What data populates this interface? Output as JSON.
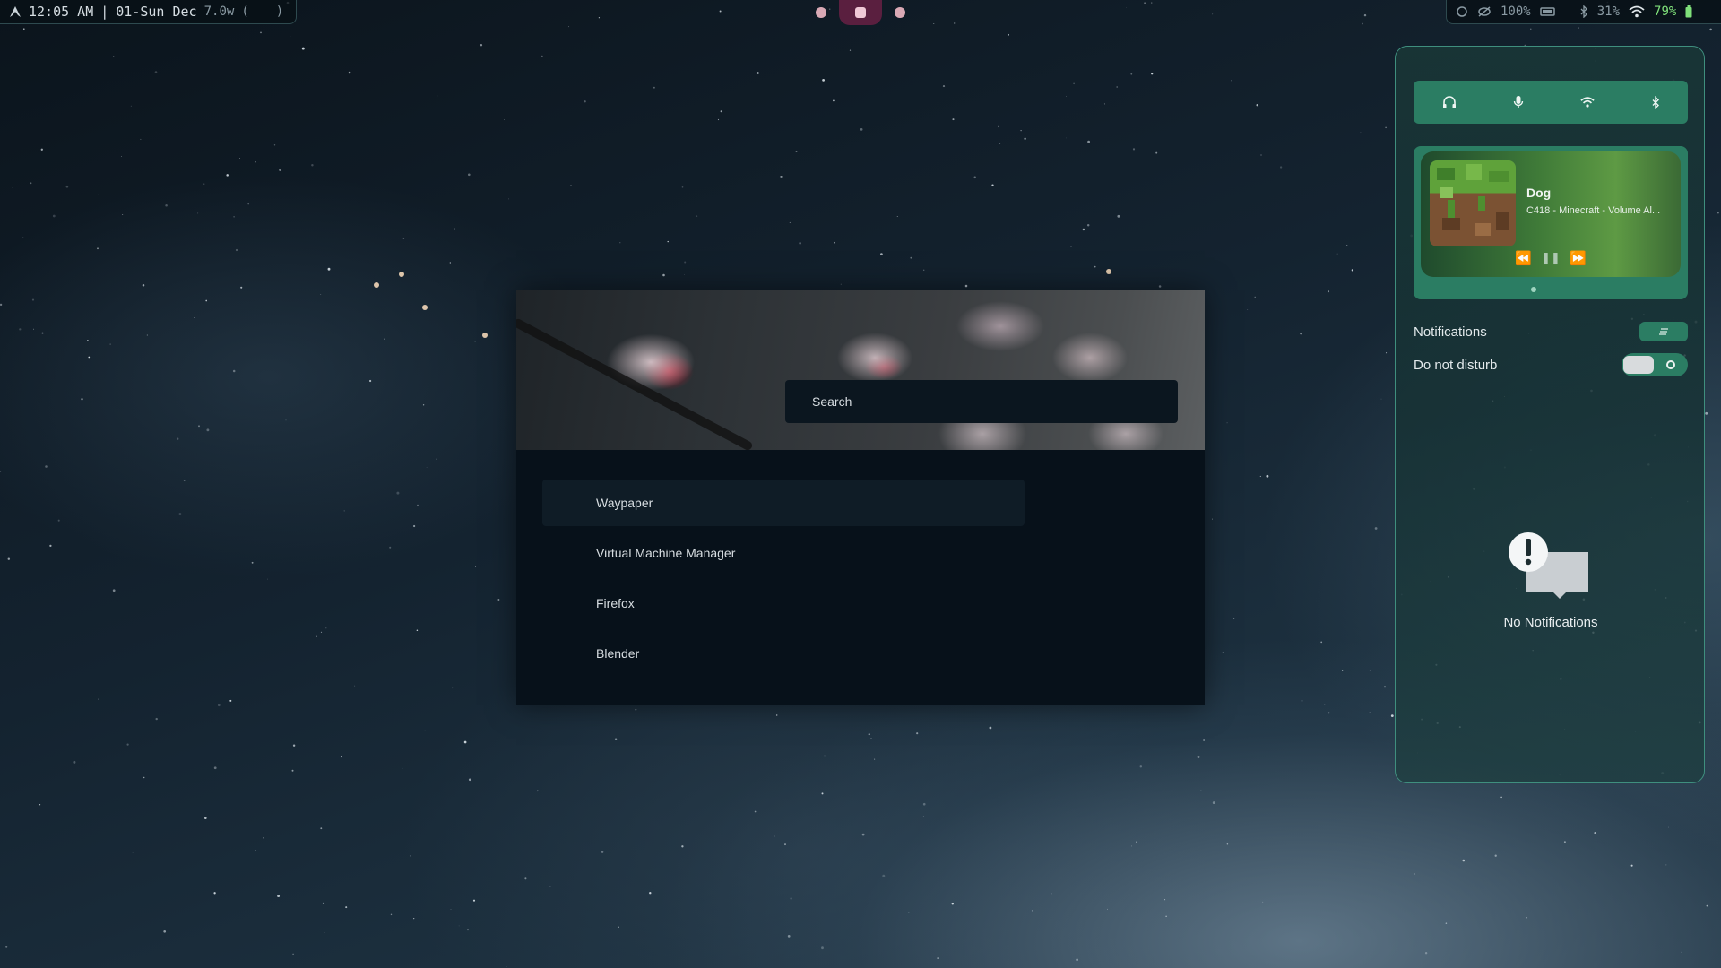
{
  "topbar": {
    "clock": "12:05 AM",
    "separator": "|",
    "date": "01-Sun Dec",
    "power": "7.0w",
    "paren_open": "(",
    "paren_close": ")",
    "brightness": "100%",
    "bt_battery": "31%",
    "battery": "79%"
  },
  "launcher": {
    "search_placeholder": "Search",
    "apps": [
      {
        "label": "Waypaper",
        "selected": true
      },
      {
        "label": "Virtual Machine Manager",
        "selected": false
      },
      {
        "label": "Firefox",
        "selected": false
      },
      {
        "label": "Blender",
        "selected": false
      }
    ]
  },
  "control_center": {
    "quick_toggles": [
      "headphones-icon",
      "microphone-icon",
      "wifi-icon",
      "bluetooth-icon"
    ],
    "player": {
      "title": "Dog",
      "artist_album": "C418 - Minecraft - Volume Al...",
      "controls": [
        "previous-icon",
        "pause-icon",
        "next-icon"
      ]
    },
    "notifications_label": "Notifications",
    "dnd_label": "Do not disturb",
    "empty_text": "No Notifications"
  },
  "colors": {
    "accent": "#2b7d63",
    "panel_border": "#3f8f7e",
    "workspace_active": "#5a1f3f",
    "battery_green": "#7fe07a"
  }
}
